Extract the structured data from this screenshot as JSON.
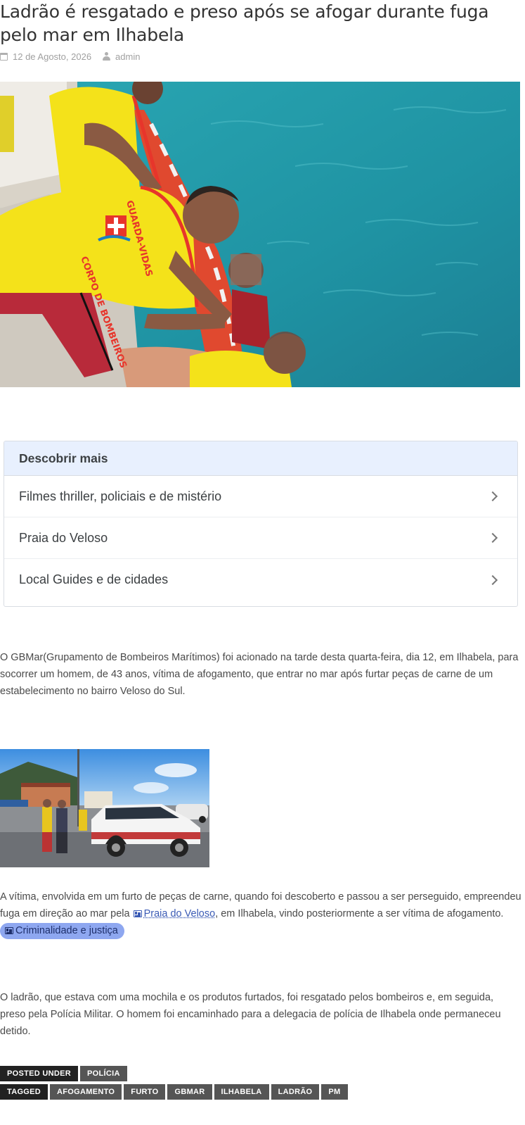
{
  "article": {
    "title": "Ladrão é resgatado e preso após se afogar durante fuga pelo mar em Ilhabela",
    "date": "12 de Agosto, 2026",
    "author": "admin"
  },
  "discover": {
    "heading": "Descobrir mais",
    "items": [
      "Filmes thriller, policiais e de mistério",
      "Praia do Veloso",
      "Local Guides e de cidades"
    ]
  },
  "body": {
    "p1": "O GBMar(Grupamento de Bombeiros Marítimos) foi acionado na tarde desta quarta-feira, dia 12, em Ilhabela, para socorrer um homem, de 43 anos, vítima de afogamento,  que entrar no mar após furtar peças de carne de um estabelecimento no bairro Veloso do Sul.",
    "p2_before": "A vítima, envolvida em um furto de peças de carne, quando foi descoberto e passou a ser perseguido, empreendeu fuga em direção ao mar pela ",
    "p2_link": "Praia do Veloso",
    "p2_after": ", em Ilhabela, vindo posteriormente a ser vítima de afogamento. ",
    "p2_pill": "Criminalidade e justiça",
    "p3": "O ladrão, que estava com uma mochila e os produtos furtados, foi resgatado pelos bombeiros e, em seguida, preso pela Polícia Militar.  O homem foi encaminhado para a delegacia de polícia de Ilhabela onde permaneceu detido."
  },
  "footer": {
    "posted_label": "POSTED UNDER",
    "categories": [
      "POLÍCIA"
    ],
    "tagged_label": "TAGGED",
    "tags": [
      "AFOGAMENTO",
      "FURTO",
      "GBMAR",
      "ILHABELA",
      "LADRÃO",
      "PM"
    ]
  },
  "colors": {
    "discover_header_bg": "#e8f0fe",
    "link": "#3b5bb5",
    "pill_bg": "#8ea7f0",
    "tag_label_bg": "#222222",
    "tag_bg": "#555555"
  },
  "icons": {
    "date": "calendar-icon",
    "author": "user-icon",
    "discover_chevron": "chevron-right-icon",
    "inline_link": "document-icon"
  }
}
